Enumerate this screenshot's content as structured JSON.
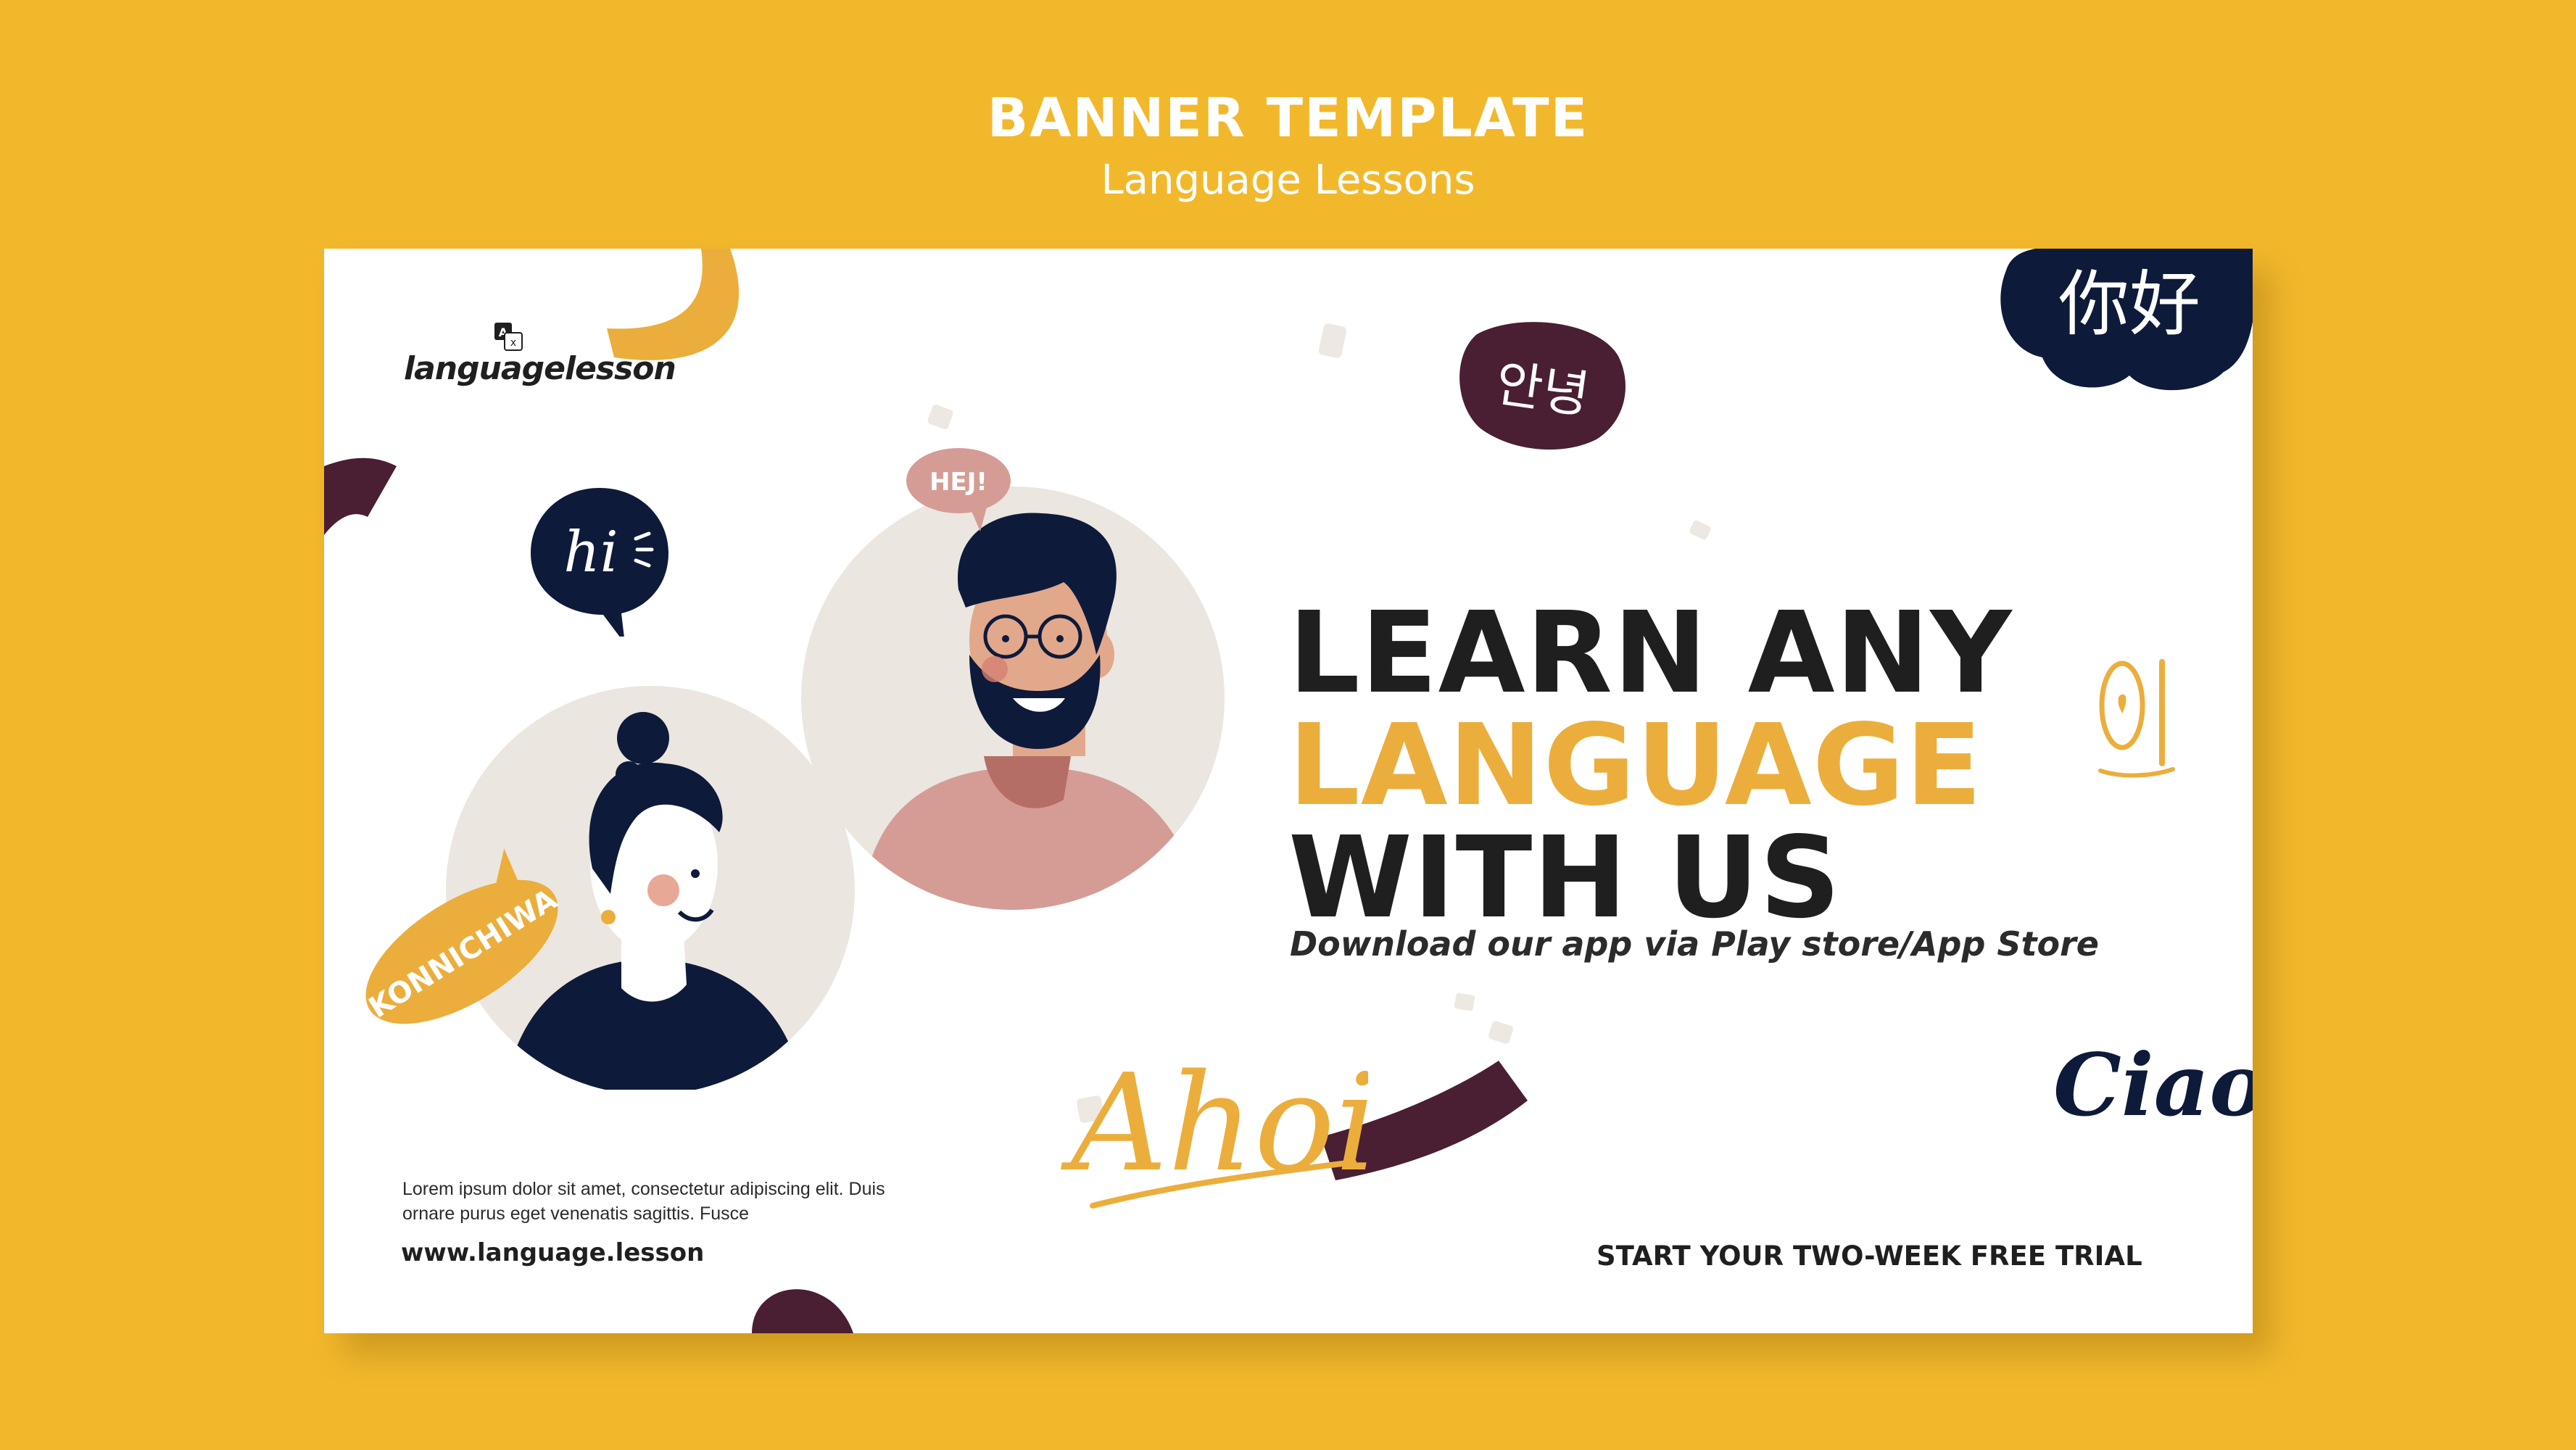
{
  "header": {
    "title": "BANNER TEMPLATE",
    "subtitle": "Language Lessons"
  },
  "banner": {
    "logo": {
      "text": "languagelesson",
      "icon": "translate-icon"
    },
    "headline": {
      "line1": "LEARN ANY",
      "line2": "LANGUAGE",
      "line3": "WITH US"
    },
    "subtitle": "Download our app via  Play store/App Store",
    "body_text": "Lorem ipsum dolor sit amet, consectetur adipiscing elit. Duis ornare purus eget venenatis sagittis. Fusce",
    "url": "www.language.lesson",
    "cta": "START YOUR TWO-WEEK FREE TRIAL",
    "greetings": {
      "hi": "hi",
      "hej": "HEJ!",
      "konnichiwa": "KONNICHIWA",
      "nihao": "你好",
      "annyeong": "안녕",
      "ahoi": "Ahoi",
      "ciao": "Ciao"
    }
  },
  "colors": {
    "background": "#F2B82C",
    "accent_yellow": "#EBAE3C",
    "dark_navy": "#0E1A3A",
    "plum": "#4A1E33",
    "text_dark": "#1F1F1F",
    "circle_beige": "#EBE6E0"
  }
}
